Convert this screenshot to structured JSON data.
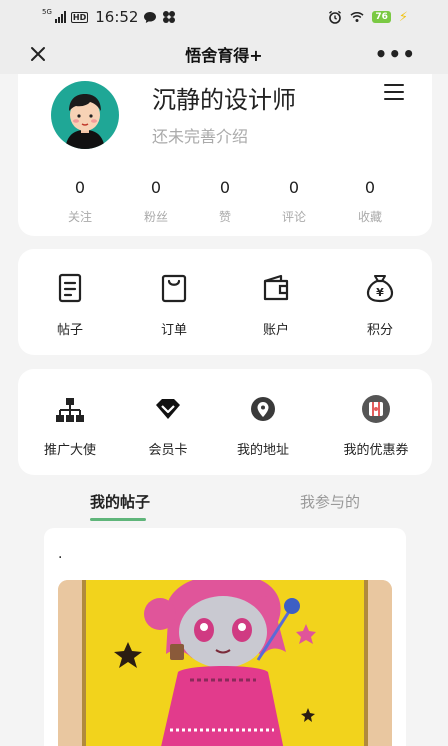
{
  "status_bar": {
    "network": "5G",
    "hd": "HD",
    "time": "16:52",
    "battery": "76"
  },
  "header": {
    "title": "悟舍育得+"
  },
  "profile": {
    "name": "沉静的设计师",
    "bio": "还未完善介绍",
    "stats": [
      {
        "value": "0",
        "label": "关注"
      },
      {
        "value": "0",
        "label": "粉丝"
      },
      {
        "value": "0",
        "label": "赞"
      },
      {
        "value": "0",
        "label": "评论"
      },
      {
        "value": "0",
        "label": "收藏"
      }
    ]
  },
  "quick_actions": [
    {
      "label": "帖子",
      "icon": "post-icon"
    },
    {
      "label": "订单",
      "icon": "shopping-bag-icon"
    },
    {
      "label": "账户",
      "icon": "wallet-icon"
    },
    {
      "label": "积分",
      "icon": "money-bag-icon"
    }
  ],
  "services": [
    {
      "label": "推广大使",
      "icon": "network-icon"
    },
    {
      "label": "会员卡",
      "icon": "diamond-icon"
    },
    {
      "label": "我的地址",
      "icon": "location-icon"
    },
    {
      "label": "我的优惠券",
      "icon": "coupon-icon"
    }
  ],
  "tabs": {
    "active": "我的帖子",
    "inactive": "我参与的"
  },
  "post": {
    "text": "."
  },
  "colors": {
    "accent": "#5fb57a",
    "avatar_bg": "#1fa796",
    "battery": "#7ac943"
  }
}
